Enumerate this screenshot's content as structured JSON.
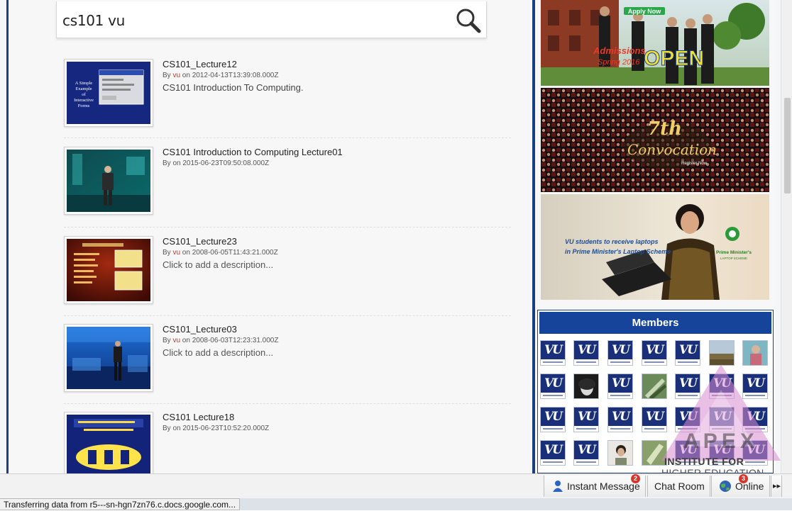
{
  "search": {
    "query": "cs101 vu"
  },
  "results": [
    {
      "title": "CS101_Lecture12",
      "by_label": "By",
      "user": "vu",
      "on_label": "on",
      "date": "2012-04-13T13:39:08.000Z",
      "description": "CS101 Introduction To Computing.",
      "thumb_text": [
        "A Simple",
        "Example",
        "of",
        "Interactive",
        "Forms"
      ]
    },
    {
      "title": "CS101 Introduction to Computing Lecture01",
      "by_label": "By",
      "user": "",
      "on_label": "on",
      "date": "2015-06-23T09:50:08.000Z",
      "description": ""
    },
    {
      "title": "CS101_Lecture23",
      "by_label": "By",
      "user": "vu",
      "on_label": "on",
      "date": "2008-06-05T11:43:21.000Z",
      "description": "Click to add a description..."
    },
    {
      "title": "CS101_Lecture03",
      "by_label": "By",
      "user": "vu",
      "on_label": "on",
      "date": "2008-06-03T12:23:31.000Z",
      "description": "Click to add a description..."
    },
    {
      "title": "CS101 Lecture18",
      "by_label": "By",
      "user": "",
      "on_label": "on",
      "date": "2015-06-23T10:52:20.000Z",
      "description": ""
    }
  ],
  "banners": {
    "admissions": {
      "apply_now": "Apply Now",
      "admissions": "Admissions",
      "spring": "Spring 2016",
      "open": "OPEN"
    },
    "convocation": {
      "ordinal": "7th",
      "title": "Convocation",
      "register": "Register Now"
    },
    "laptop": {
      "line1": "VU students to receive laptops",
      "line2": "in Prime Minister's Laptop Scheme",
      "logo_line1": "Prime Minister's",
      "logo_line2": "LAPTOP SCHEME"
    }
  },
  "members": {
    "title": "Members"
  },
  "chat_bar": {
    "instant_message": "Instant Message",
    "instant_message_badge": "2",
    "chat_room": "Chat Room",
    "online": "Online",
    "online_badge": "3"
  },
  "status": {
    "text": "Transferring data from r5---sn-hgn7zn76.c.docs.google.com..."
  },
  "watermark": {
    "brand": "APEX",
    "line1": "INSTITUTE FOR",
    "line2": "HIGHER EDUCATION"
  },
  "colors": {
    "accent": "#16449a",
    "user_link": "#c0392b",
    "frame": "#1e3f82"
  }
}
